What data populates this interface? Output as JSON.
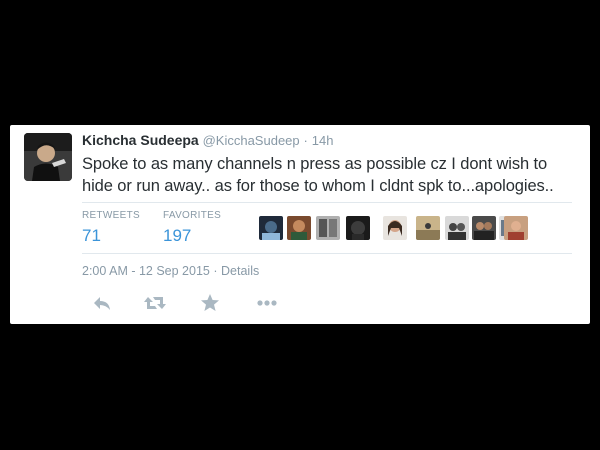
{
  "tweet": {
    "author_name": "Kichcha Sudeepa",
    "author_handle": "@KicchaSudeep",
    "separator": "·",
    "time_ago": "14h",
    "text": "Spoke to as many channels n press as possible cz I dont wish to hide or run away.. as for those to whom I cldnt spk to...apologies..",
    "stats": {
      "retweets_label": "RETWEETS",
      "retweets_value": "71",
      "favorites_label": "FAVORITES",
      "favorites_value": "197"
    },
    "timestamp": "2:00 AM - 12 Sep 2015",
    "meta_separator": "·",
    "details_link": "Details",
    "actions": [
      "reply-icon",
      "retweet-icon",
      "favorite-icon",
      "more-icon"
    ],
    "favoriter_avatars": 10
  },
  "colors": {
    "background": "#000000",
    "card": "#ffffff",
    "name": "#292f33",
    "muted": "#8899a6",
    "accent": "#3b94d9",
    "divider": "#e1e8ed"
  }
}
